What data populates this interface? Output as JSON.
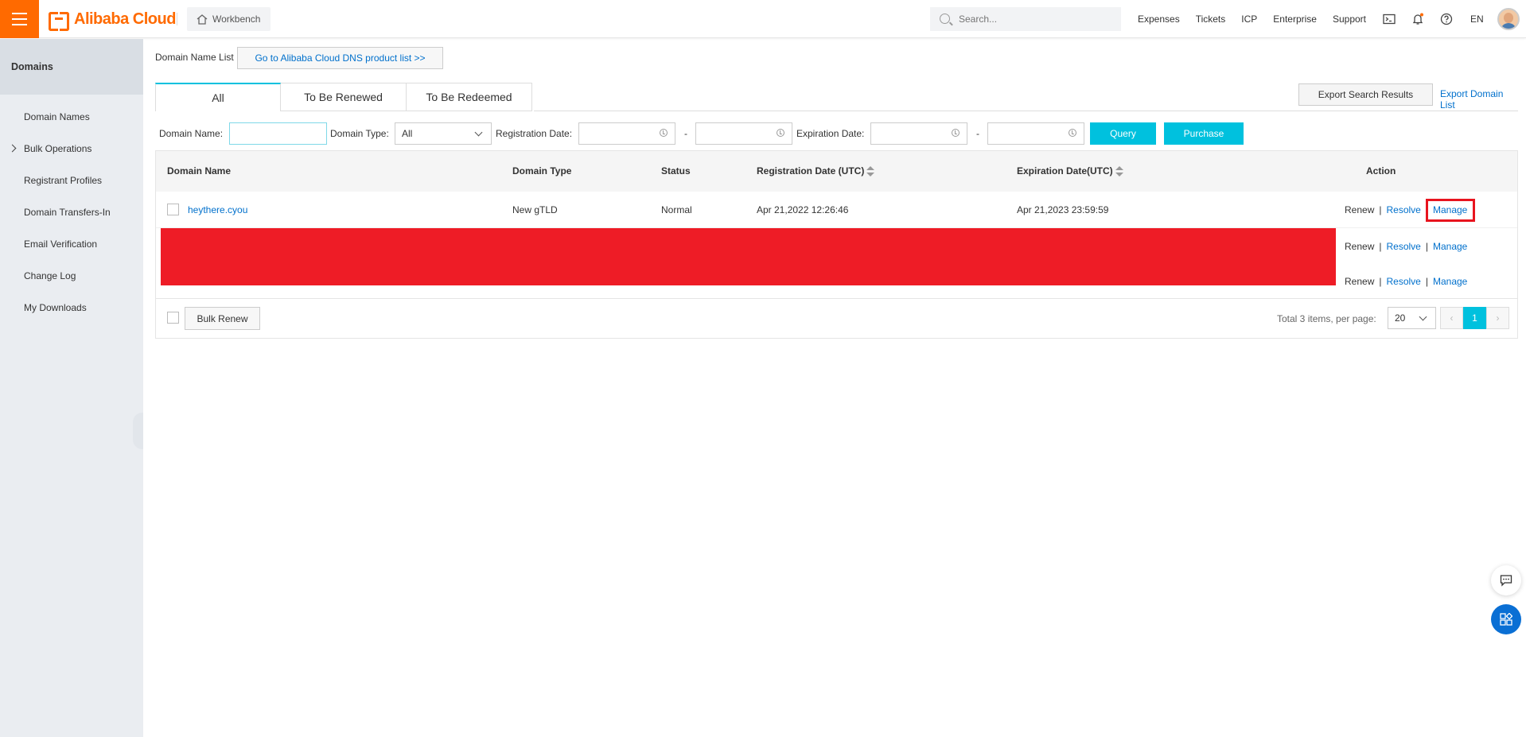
{
  "header": {
    "logo_text": "Alibaba Cloud",
    "workbench_label": "Workbench",
    "search_placeholder": "Search...",
    "nav_links": [
      "Expenses",
      "Tickets",
      "ICP",
      "Enterprise",
      "Support"
    ],
    "language": "EN",
    "brand_color": "#ff6a00"
  },
  "sidebar": {
    "title": "Domains",
    "items": [
      {
        "label": "Domain Names"
      },
      {
        "label": "Bulk Operations"
      },
      {
        "label": "Registrant Profiles"
      },
      {
        "label": "Domain Transfers-In"
      },
      {
        "label": "Email Verification"
      },
      {
        "label": "Change Log"
      },
      {
        "label": "My Downloads"
      }
    ]
  },
  "main": {
    "list_label": "Domain Name List",
    "dns_link": "Go to Alibaba Cloud DNS product list >>",
    "tabs": [
      "All",
      "To Be Renewed",
      "To Be Redeemed"
    ],
    "export_search_results": "Export Search Results",
    "export_domain_list": "Export Domain List",
    "filters": {
      "domain_name_label": "Domain Name:",
      "domain_name_value": "",
      "domain_type_label": "Domain Type:",
      "domain_type_value": "All",
      "registration_date_label": "Registration Date:",
      "expiration_date_label": "Expiration Date:",
      "range_dash": "-",
      "query_label": "Query",
      "purchase_label": "Purchase"
    },
    "table": {
      "columns": [
        "Domain Name",
        "Domain Type",
        "Status",
        "Registration Date (UTC)",
        "Expiration Date(UTC)",
        "Action"
      ],
      "rows": [
        {
          "domain": "heythere.cyou",
          "type": "New gTLD",
          "status": "Normal",
          "registered": "Apr 21,2022 12:26:46",
          "expires": "Apr 21,2023 23:59:59"
        }
      ],
      "actions": {
        "renew": "Renew",
        "resolve": "Resolve",
        "manage": "Manage",
        "separator": "|"
      }
    },
    "footer": {
      "bulk_renew": "Bulk Renew",
      "total_text": "Total 3 items,  per page:",
      "per_page": "20",
      "current_page": "1",
      "prev": "‹",
      "next": "›"
    }
  }
}
